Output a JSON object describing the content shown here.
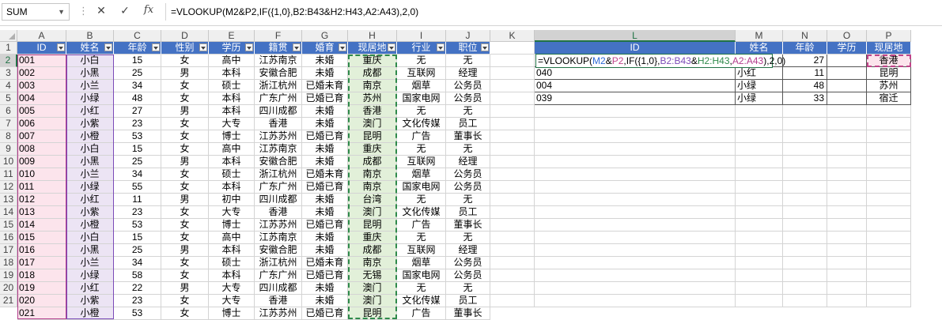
{
  "formula_bar": {
    "namebox": "SUM",
    "cancel_icon": "✕",
    "enter_icon": "✓",
    "fx_icon": "fx",
    "formula": "=VLOOKUP(M2&P2,IF({1,0},B2:B43&H2:H43,A2:A43),2,0)"
  },
  "columns": [
    "A",
    "B",
    "C",
    "D",
    "E",
    "F",
    "G",
    "H",
    "I",
    "J",
    "K",
    "L",
    "M",
    "N",
    "O",
    "P"
  ],
  "rows": [
    "1",
    "2",
    "3",
    "4",
    "5",
    "6",
    "7",
    "8",
    "9",
    "10",
    "11",
    "12",
    "13",
    "14",
    "15",
    "16",
    "17",
    "18",
    "19",
    "20",
    "21"
  ],
  "table_headers": [
    "ID",
    "姓名",
    "年龄",
    "性别",
    "学历",
    "籍贯",
    "婚育",
    "现居地",
    "行业",
    "职位"
  ],
  "table_rows": [
    [
      "001",
      "小白",
      "15",
      "女",
      "高中",
      "江苏南京",
      "未婚",
      "重庆",
      "无",
      "无"
    ],
    [
      "002",
      "小黑",
      "25",
      "男",
      "本科",
      "安徽合肥",
      "未婚",
      "成都",
      "互联网",
      "经理"
    ],
    [
      "003",
      "小兰",
      "34",
      "女",
      "硕士",
      "浙江杭州",
      "已婚未育",
      "南京",
      "烟草",
      "公务员"
    ],
    [
      "004",
      "小绿",
      "48",
      "女",
      "本科",
      "广东广州",
      "已婚已育",
      "苏州",
      "国家电网",
      "公务员"
    ],
    [
      "005",
      "小红",
      "27",
      "男",
      "本科",
      "四川成都",
      "未婚",
      "香港",
      "无",
      "无"
    ],
    [
      "006",
      "小紫",
      "23",
      "女",
      "大专",
      "香港",
      "未婚",
      "澳门",
      "文化传媒",
      "员工"
    ],
    [
      "007",
      "小橙",
      "53",
      "女",
      "博士",
      "江苏苏州",
      "已婚已育",
      "昆明",
      "广告",
      "董事长"
    ],
    [
      "008",
      "小白",
      "15",
      "女",
      "高中",
      "江苏南京",
      "未婚",
      "重庆",
      "无",
      "无"
    ],
    [
      "009",
      "小黑",
      "25",
      "男",
      "本科",
      "安徽合肥",
      "未婚",
      "成都",
      "互联网",
      "经理"
    ],
    [
      "010",
      "小兰",
      "34",
      "女",
      "硕士",
      "浙江杭州",
      "已婚未育",
      "南京",
      "烟草",
      "公务员"
    ],
    [
      "011",
      "小绿",
      "55",
      "女",
      "本科",
      "广东广州",
      "已婚已育",
      "南京",
      "国家电网",
      "公务员"
    ],
    [
      "012",
      "小红",
      "11",
      "男",
      "初中",
      "四川成都",
      "未婚",
      "台湾",
      "无",
      "无"
    ],
    [
      "013",
      "小紫",
      "23",
      "女",
      "大专",
      "香港",
      "未婚",
      "澳门",
      "文化传媒",
      "员工"
    ],
    [
      "014",
      "小橙",
      "53",
      "女",
      "博士",
      "江苏苏州",
      "已婚已育",
      "昆明",
      "广告",
      "董事长"
    ],
    [
      "015",
      "小白",
      "15",
      "女",
      "高中",
      "江苏南京",
      "未婚",
      "重庆",
      "无",
      "无"
    ],
    [
      "016",
      "小黑",
      "25",
      "男",
      "本科",
      "安徽合肥",
      "未婚",
      "成都",
      "互联网",
      "经理"
    ],
    [
      "017",
      "小兰",
      "34",
      "女",
      "硕士",
      "浙江杭州",
      "已婚未育",
      "南京",
      "烟草",
      "公务员"
    ],
    [
      "018",
      "小绿",
      "58",
      "女",
      "本科",
      "广东广州",
      "已婚已育",
      "无锡",
      "国家电网",
      "公务员"
    ],
    [
      "019",
      "小红",
      "22",
      "男",
      "大专",
      "四川成都",
      "未婚",
      "澳门",
      "无",
      "无"
    ],
    [
      "020",
      "小紫",
      "23",
      "女",
      "大专",
      "香港",
      "未婚",
      "澳门",
      "文化传媒",
      "员工"
    ],
    [
      "021",
      "小橙",
      "53",
      "女",
      "博士",
      "江苏苏州",
      "已婚已育",
      "昆明",
      "广告",
      "董事长"
    ]
  ],
  "lookup_headers": [
    "ID",
    "姓名",
    "年龄",
    "学历",
    "现居地"
  ],
  "lookup_rows": [
    [
      "",
      "",
      "27",
      "",
      "香港"
    ],
    [
      "040",
      "小红",
      "11",
      "",
      "昆明"
    ],
    [
      "004",
      "小绿",
      "48",
      "",
      "苏州"
    ],
    [
      "039",
      "小绿",
      "33",
      "",
      "宿迁"
    ]
  ],
  "edit_formula": {
    "p1": "=VLOOKUP(",
    "p2": "M2",
    "p3": "&",
    "p4": "P2",
    "p5": ",IF({1,0},",
    "p6": "B2:B43",
    "p7": "&",
    "p8": "H2:H43",
    "p9": ",",
    "p10": "A2:A43",
    "p11": "),2,0)"
  }
}
